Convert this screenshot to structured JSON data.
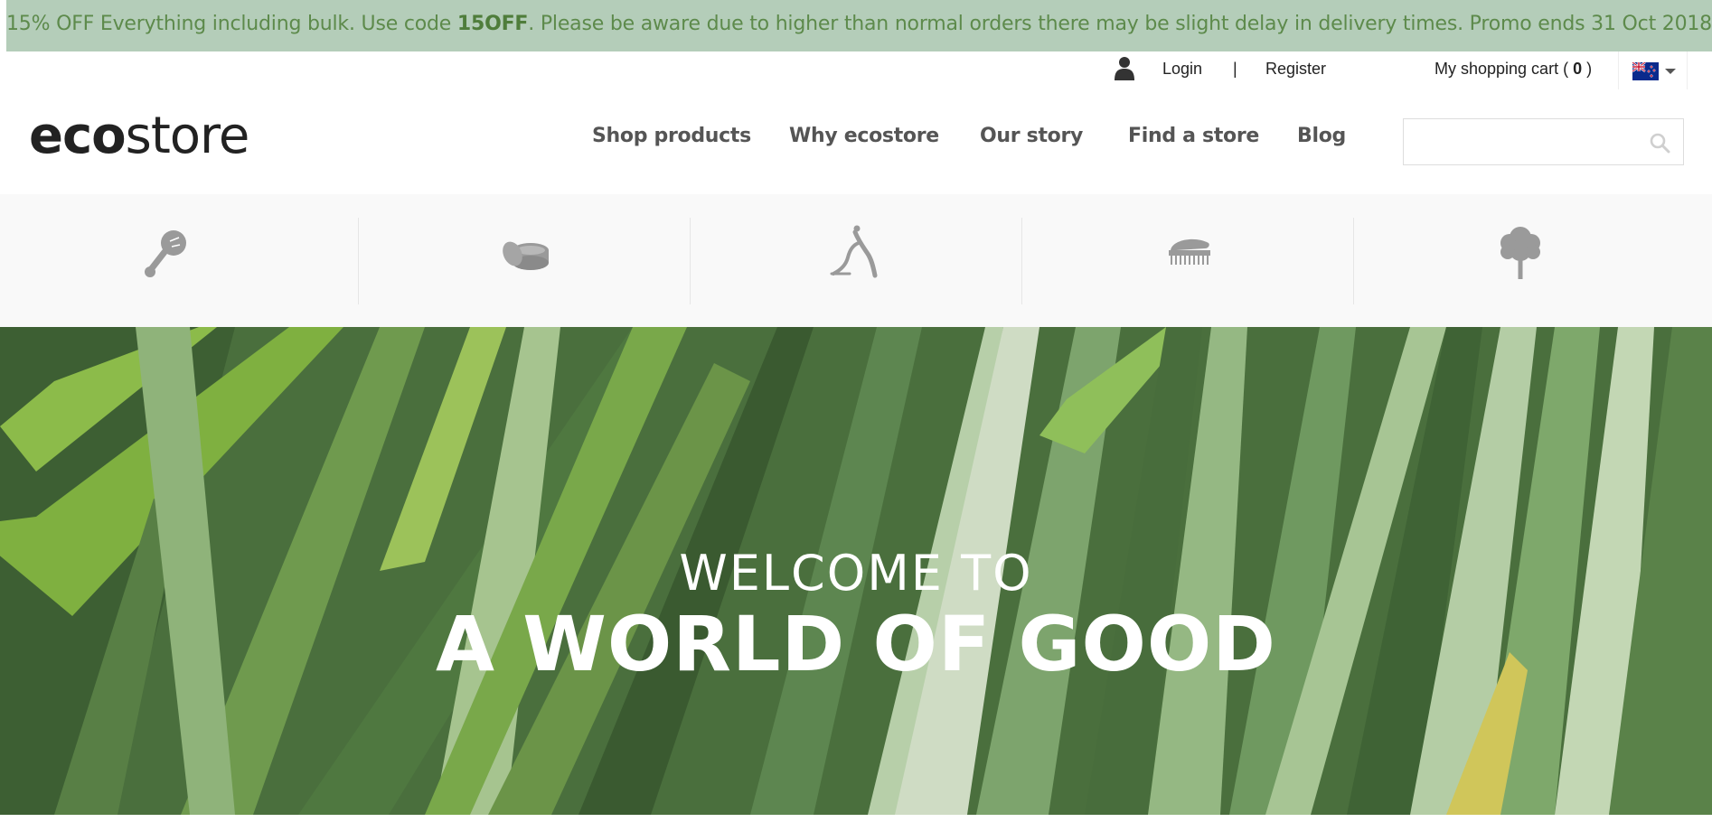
{
  "promo": {
    "before": "15% OFF Everything including bulk. Use code ",
    "code": "15OFF",
    "after": ". Please be aware due to higher than normal orders there may be slight delay in delivery times. Promo ends 31 Oct 2018."
  },
  "utility": {
    "user_icon": "user-icon",
    "login": "Login",
    "separator": "|",
    "register": "Register",
    "cart_prefix": "My shopping cart ( ",
    "cart_count": "0",
    "cart_suffix": " )",
    "country_flag": "new-zealand-flag-icon"
  },
  "logo": {
    "eco": "eco",
    "store": "store"
  },
  "nav": {
    "items": [
      {
        "label": "Shop products"
      },
      {
        "label": "Why ecostore"
      },
      {
        "label": "Our story"
      },
      {
        "label": "Find a store"
      },
      {
        "label": "Blog"
      }
    ]
  },
  "search": {
    "placeholder": "",
    "icon": "search-icon"
  },
  "categories": [
    {
      "icon": "baby-rattle-icon"
    },
    {
      "icon": "beauty-cream-icon"
    },
    {
      "icon": "yoga-pose-icon"
    },
    {
      "icon": "cleaning-brush-icon"
    },
    {
      "icon": "tree-icon"
    }
  ],
  "hero": {
    "line1": "WELCOME TO",
    "line2": "A WORLD OF GOOD"
  },
  "colors": {
    "promo_bg": "#b4cdb9",
    "promo_text": "#5d8a4b",
    "nav_text": "#555555",
    "category_bar_bg": "#f9f9f9",
    "icon_grey": "#9a9a9a"
  }
}
